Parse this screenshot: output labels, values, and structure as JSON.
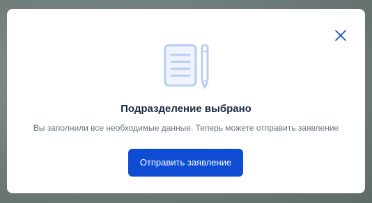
{
  "dialog": {
    "title": "Подразделение выбрано",
    "message": "Вы заполнили все необходимые данные. Теперь можете отправить заявление",
    "primary_button_label": "Отправить заявление",
    "close_icon": "close-icon",
    "illustration_icon": "document-with-pencil-icon"
  },
  "colors": {
    "accent": "#0d4cd3",
    "title_text": "#1f2a44",
    "body_text": "#66727f",
    "illustration": "#b9ccf2"
  }
}
